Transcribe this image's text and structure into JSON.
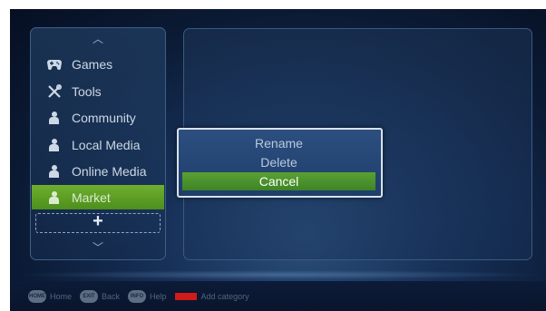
{
  "sidebar": {
    "items": [
      {
        "label": "Games",
        "icon": "gamepad-icon"
      },
      {
        "label": "Tools",
        "icon": "tools-icon"
      },
      {
        "label": "Community",
        "icon": "person-icon"
      },
      {
        "label": "Local Media",
        "icon": "person-icon"
      },
      {
        "label": "Online Media",
        "icon": "person-icon"
      },
      {
        "label": "Market",
        "icon": "person-icon",
        "selected": true
      }
    ],
    "add_symbol": "+",
    "scroll_up_symbol": "︿",
    "scroll_down_symbol": "﹀"
  },
  "dialog": {
    "options": [
      "Rename",
      "Delete",
      "Cancel"
    ],
    "selected": "Cancel"
  },
  "bottom_bar": {
    "hints": [
      {
        "button": "HOME",
        "label": "Home"
      },
      {
        "button": "EXIT",
        "label": "Back"
      },
      {
        "button": "INFO",
        "label": "Help"
      },
      {
        "button": "RED",
        "label": "Add category"
      }
    ]
  },
  "colors": {
    "accent_green": "#5aa133",
    "panel_border": "#3d5f86",
    "background_dark": "#0b1a34",
    "red_key": "#d11a1a"
  }
}
